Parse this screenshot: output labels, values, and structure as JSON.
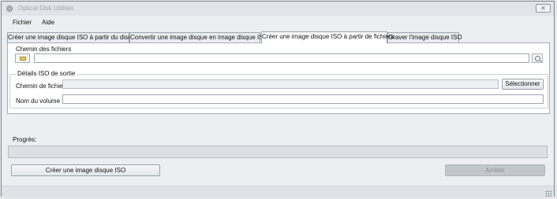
{
  "window": {
    "title": "Optical Disk Utilities",
    "close_glyph": "✕"
  },
  "menu": {
    "items": [
      "Fichier",
      "Aide"
    ]
  },
  "tabs": [
    {
      "label": "Créer une image disque ISO à partir du disque"
    },
    {
      "label": "Convertir une image disque en image disque ISO"
    },
    {
      "label": "Créer une image disque ISO à partir de fichiers",
      "active": true
    },
    {
      "label": "Graver l'image disque ISO"
    }
  ],
  "panel": {
    "source": {
      "label": "Chemin des fichiers",
      "value": "",
      "folder_icon": "folder-icon",
      "search_icon": "search-icon"
    },
    "output": {
      "group_title": "Détails ISO de sortie",
      "file_path_label": "Chemin de fichier",
      "file_path_value": "",
      "select_button": "Sélectionner",
      "volume_label": "Nom du volume",
      "volume_value": ""
    }
  },
  "progress": {
    "label": "Progrès:",
    "value": 0
  },
  "actions": {
    "create_button": "Créer une image disque ISO",
    "stop_button": "Arrêter"
  },
  "colors": {
    "progress_fill": "#5fc24f",
    "disabled_button": "#c3c7cc"
  }
}
